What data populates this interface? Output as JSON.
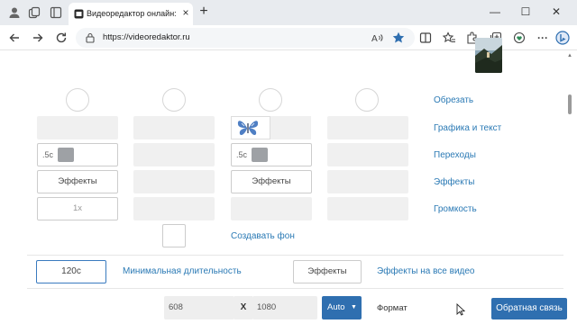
{
  "browser": {
    "tab_title": "Видеоредактор онлайн: обрезать",
    "url": "https://videoredaktor.ru",
    "icons": {
      "profile": "profile-icon",
      "workspaces": "workspaces-icon",
      "tab_actions": "tab-actions-icon",
      "close_tab": "close-icon",
      "new_tab": "plus-icon",
      "back": "back-arrow-icon",
      "forward": "forward-arrow-icon",
      "refresh": "refresh-icon",
      "lock": "lock-icon",
      "read_aloud": "read-aloud-icon",
      "favorite": "star-icon",
      "split": "split-screen-icon",
      "favorites": "favorites-icon",
      "extensions": "extensions-icon",
      "collections": "collections-icon",
      "more": "more-icon",
      "bing": "bing-icon"
    },
    "close_glyph": "×",
    "newtab_glyph": "+",
    "more_glyph": "···",
    "minimize_glyph": "—",
    "maximize_glyph": "☐",
    "window_close_glyph": "✕"
  },
  "editor": {
    "rows": [
      {
        "seconds": ".5c",
        "effects": "Эффекты",
        "volume": "1x"
      },
      {
        "seconds": ".5c",
        "effects": "Эффекты"
      }
    ],
    "side_links": [
      "Обрезать",
      "Графика и текст",
      "Переходы",
      "Эффекты",
      "Громкость"
    ],
    "create_background": "Создавать фон",
    "duration_value": "120с",
    "duration_label": "Минимальная длительность",
    "effects_button": "Эффекты",
    "effects_all": "Эффекты на все видео",
    "resolution": {
      "width": "608",
      "separator": "X",
      "height": "1080"
    },
    "auto_button": "Auto",
    "format_label": "Формат",
    "feedback_button": "Обратная связь"
  },
  "colors": {
    "accent": "#2f6fb0",
    "link": "#2b7ab5"
  }
}
